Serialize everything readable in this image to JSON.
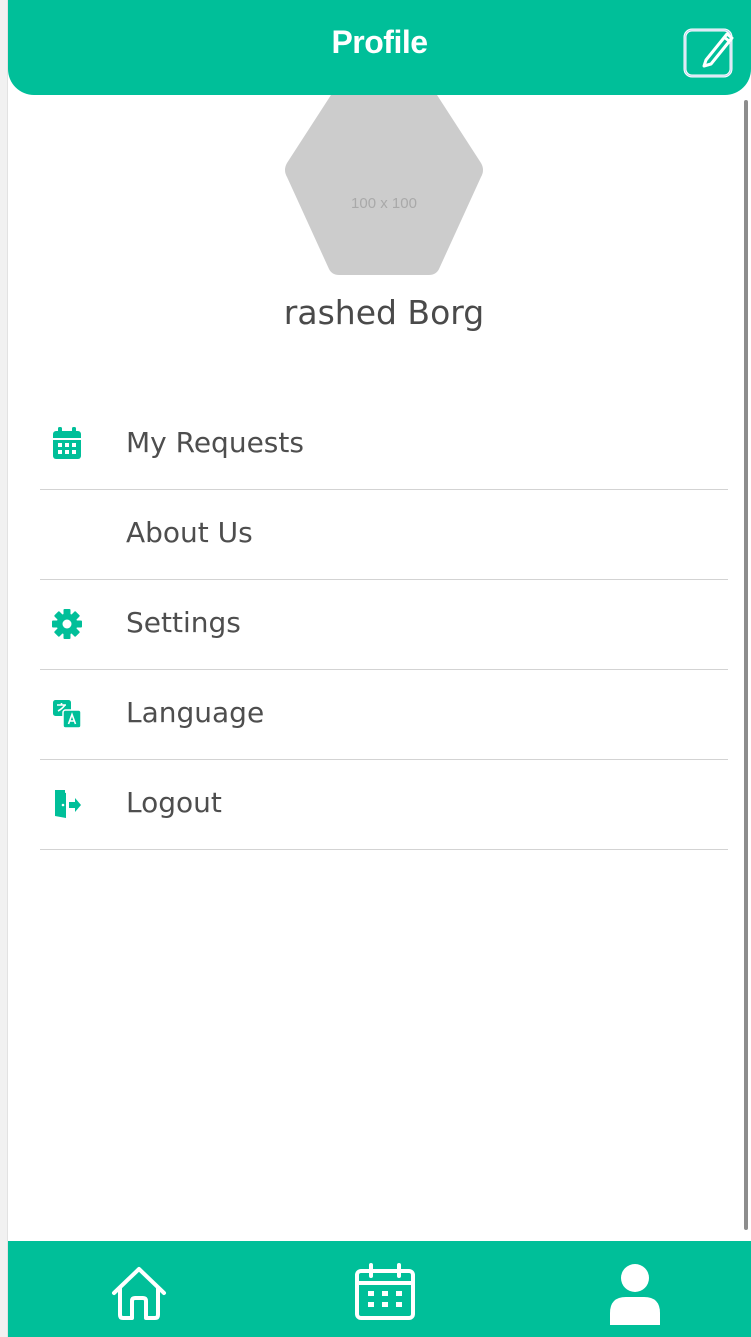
{
  "header": {
    "title": "Profile",
    "edit_icon": "edit-square-icon"
  },
  "profile": {
    "avatar_placeholder": "100 x 100",
    "name": "rashed Borg"
  },
  "menu": {
    "items": [
      {
        "label": "My Requests",
        "icon": "calendar-icon"
      },
      {
        "label": "About Us",
        "icon": ""
      },
      {
        "label": "Settings",
        "icon": "gear-icon"
      },
      {
        "label": "Language",
        "icon": "translate-icon"
      },
      {
        "label": "Logout",
        "icon": "logout-door-icon"
      }
    ]
  },
  "tabbar": {
    "tabs": [
      {
        "name": "home",
        "icon": "home-icon"
      },
      {
        "name": "calendar",
        "icon": "calendar-icon"
      },
      {
        "name": "profile",
        "icon": "user-icon",
        "active": true
      }
    ]
  },
  "colors": {
    "accent": "#00bf99",
    "text": "#4e4e4e",
    "divider": "#d3d3d3",
    "avatar_placeholder": "#cccccc"
  }
}
